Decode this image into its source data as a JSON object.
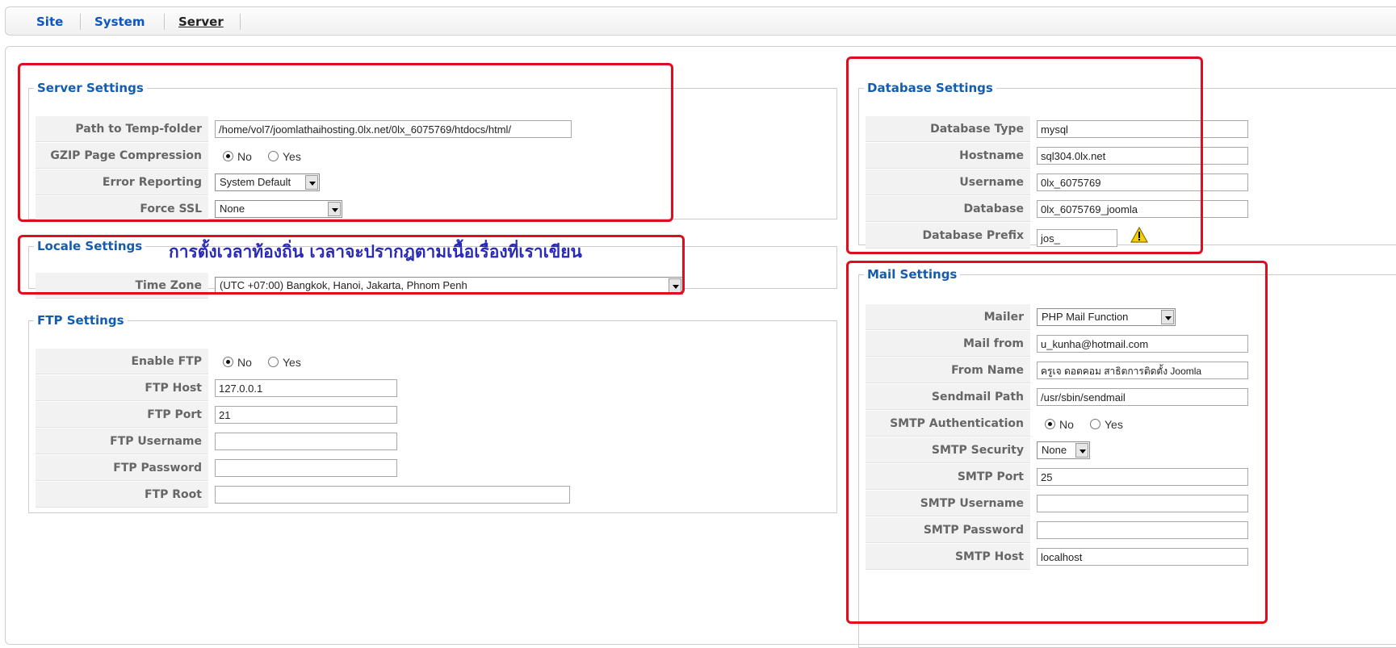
{
  "tabs": [
    "Site",
    "System",
    "Server"
  ],
  "active_tab": "Server",
  "server_settings": {
    "legend": "Server Settings",
    "temp_folder_label": "Path to Temp-folder",
    "temp_folder_value": "/home/vol7/joomlathaihosting.0lx.net/0lx_6075769/htdocs/html/",
    "gzip_label": "GZIP Page Compression",
    "gzip_no": "No",
    "gzip_yes": "Yes",
    "error_label": "Error Reporting",
    "error_value": "System Default",
    "ssl_label": "Force SSL",
    "ssl_value": "None"
  },
  "locale_settings": {
    "legend": "Locale Settings",
    "annotation": "การตั้งเวลาท้องถิ่น เวลาจะปรากฎตามเนื้อเรื่องที่เราเขียน",
    "timezone_label": "Time Zone",
    "timezone_value": "(UTC +07:00) Bangkok, Hanoi, Jakarta, Phnom Penh"
  },
  "ftp_settings": {
    "legend": "FTP Settings",
    "enable_label": "Enable FTP",
    "enable_no": "No",
    "enable_yes": "Yes",
    "host_label": "FTP Host",
    "host_value": "127.0.0.1",
    "port_label": "FTP Port",
    "port_value": "21",
    "username_label": "FTP Username",
    "password_label": "FTP Password",
    "root_label": "FTP Root"
  },
  "database_settings": {
    "legend": "Database Settings",
    "type_label": "Database Type",
    "type_value": "mysql",
    "host_label": "Hostname",
    "host_value": "sql304.0lx.net",
    "user_label": "Username",
    "user_value": "0lx_6075769",
    "db_label": "Database",
    "db_value": "0lx_6075769_joomla",
    "prefix_label": "Database Prefix",
    "prefix_value": "jos_"
  },
  "mail_settings": {
    "legend": "Mail Settings",
    "mailer_label": "Mailer",
    "mailer_value": "PHP Mail Function",
    "from_label": "Mail from",
    "from_value": "u_kunha@hotmail.com",
    "name_label": "From Name",
    "name_value": "ครูเจ ดอตคอม สาธิตการติดตั้ง Joomla",
    "sendmail_label": "Sendmail Path",
    "sendmail_value": "/usr/sbin/sendmail",
    "auth_label": "SMTP Authentication",
    "auth_no": "No",
    "auth_yes": "Yes",
    "security_label": "SMTP Security",
    "security_value": "None",
    "port_label": "SMTP Port",
    "port_value": "25",
    "user_label": "SMTP Username",
    "pass_label": "SMTP Password",
    "host_label": "SMTP Host",
    "host_value": "localhost"
  },
  "colors": {
    "legend": "#135cae",
    "tab_link": "#0b55c4",
    "highlight_frame": "#e10d1d",
    "annotation_text": "#2a2ab8"
  }
}
